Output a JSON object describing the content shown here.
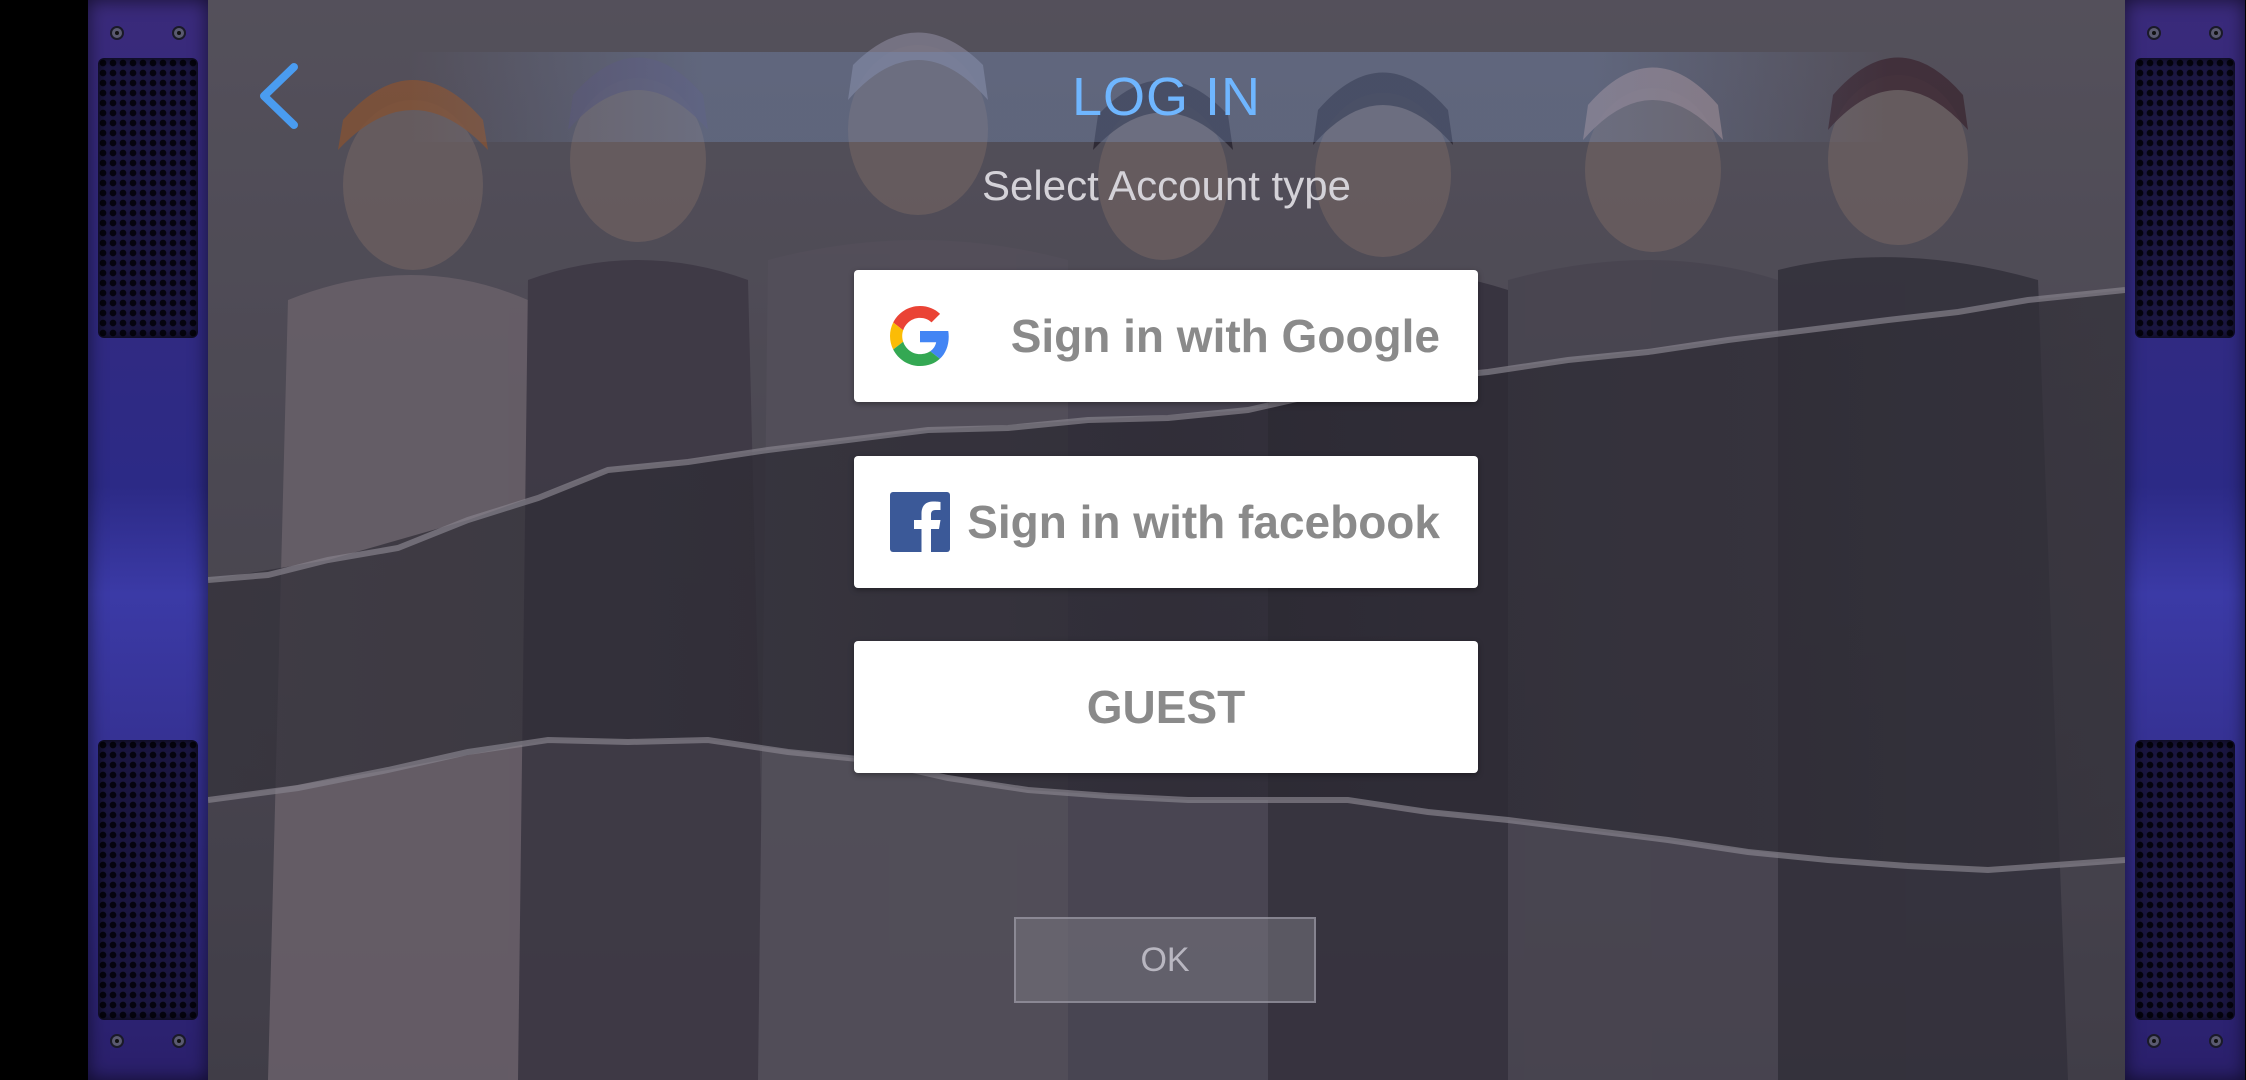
{
  "header": {
    "title": "LOG IN",
    "subtitle": "Select Account type"
  },
  "login_options": {
    "google_label": "Sign in with Google",
    "facebook_label": "Sign in with facebook",
    "guest_label": "GUEST"
  },
  "footer": {
    "ok_label": "OK"
  },
  "icons": {
    "back": "chevron-left-icon",
    "google": "google-logo-icon",
    "facebook": "facebook-logo-icon"
  },
  "colors": {
    "title": "#6fb6ff",
    "back_arrow": "#4a9cf0",
    "button_bg": "#ffffff",
    "button_text": "#8a8a8a",
    "facebook_blue": "#3b5998",
    "panel_purple": "#2c2a86"
  }
}
